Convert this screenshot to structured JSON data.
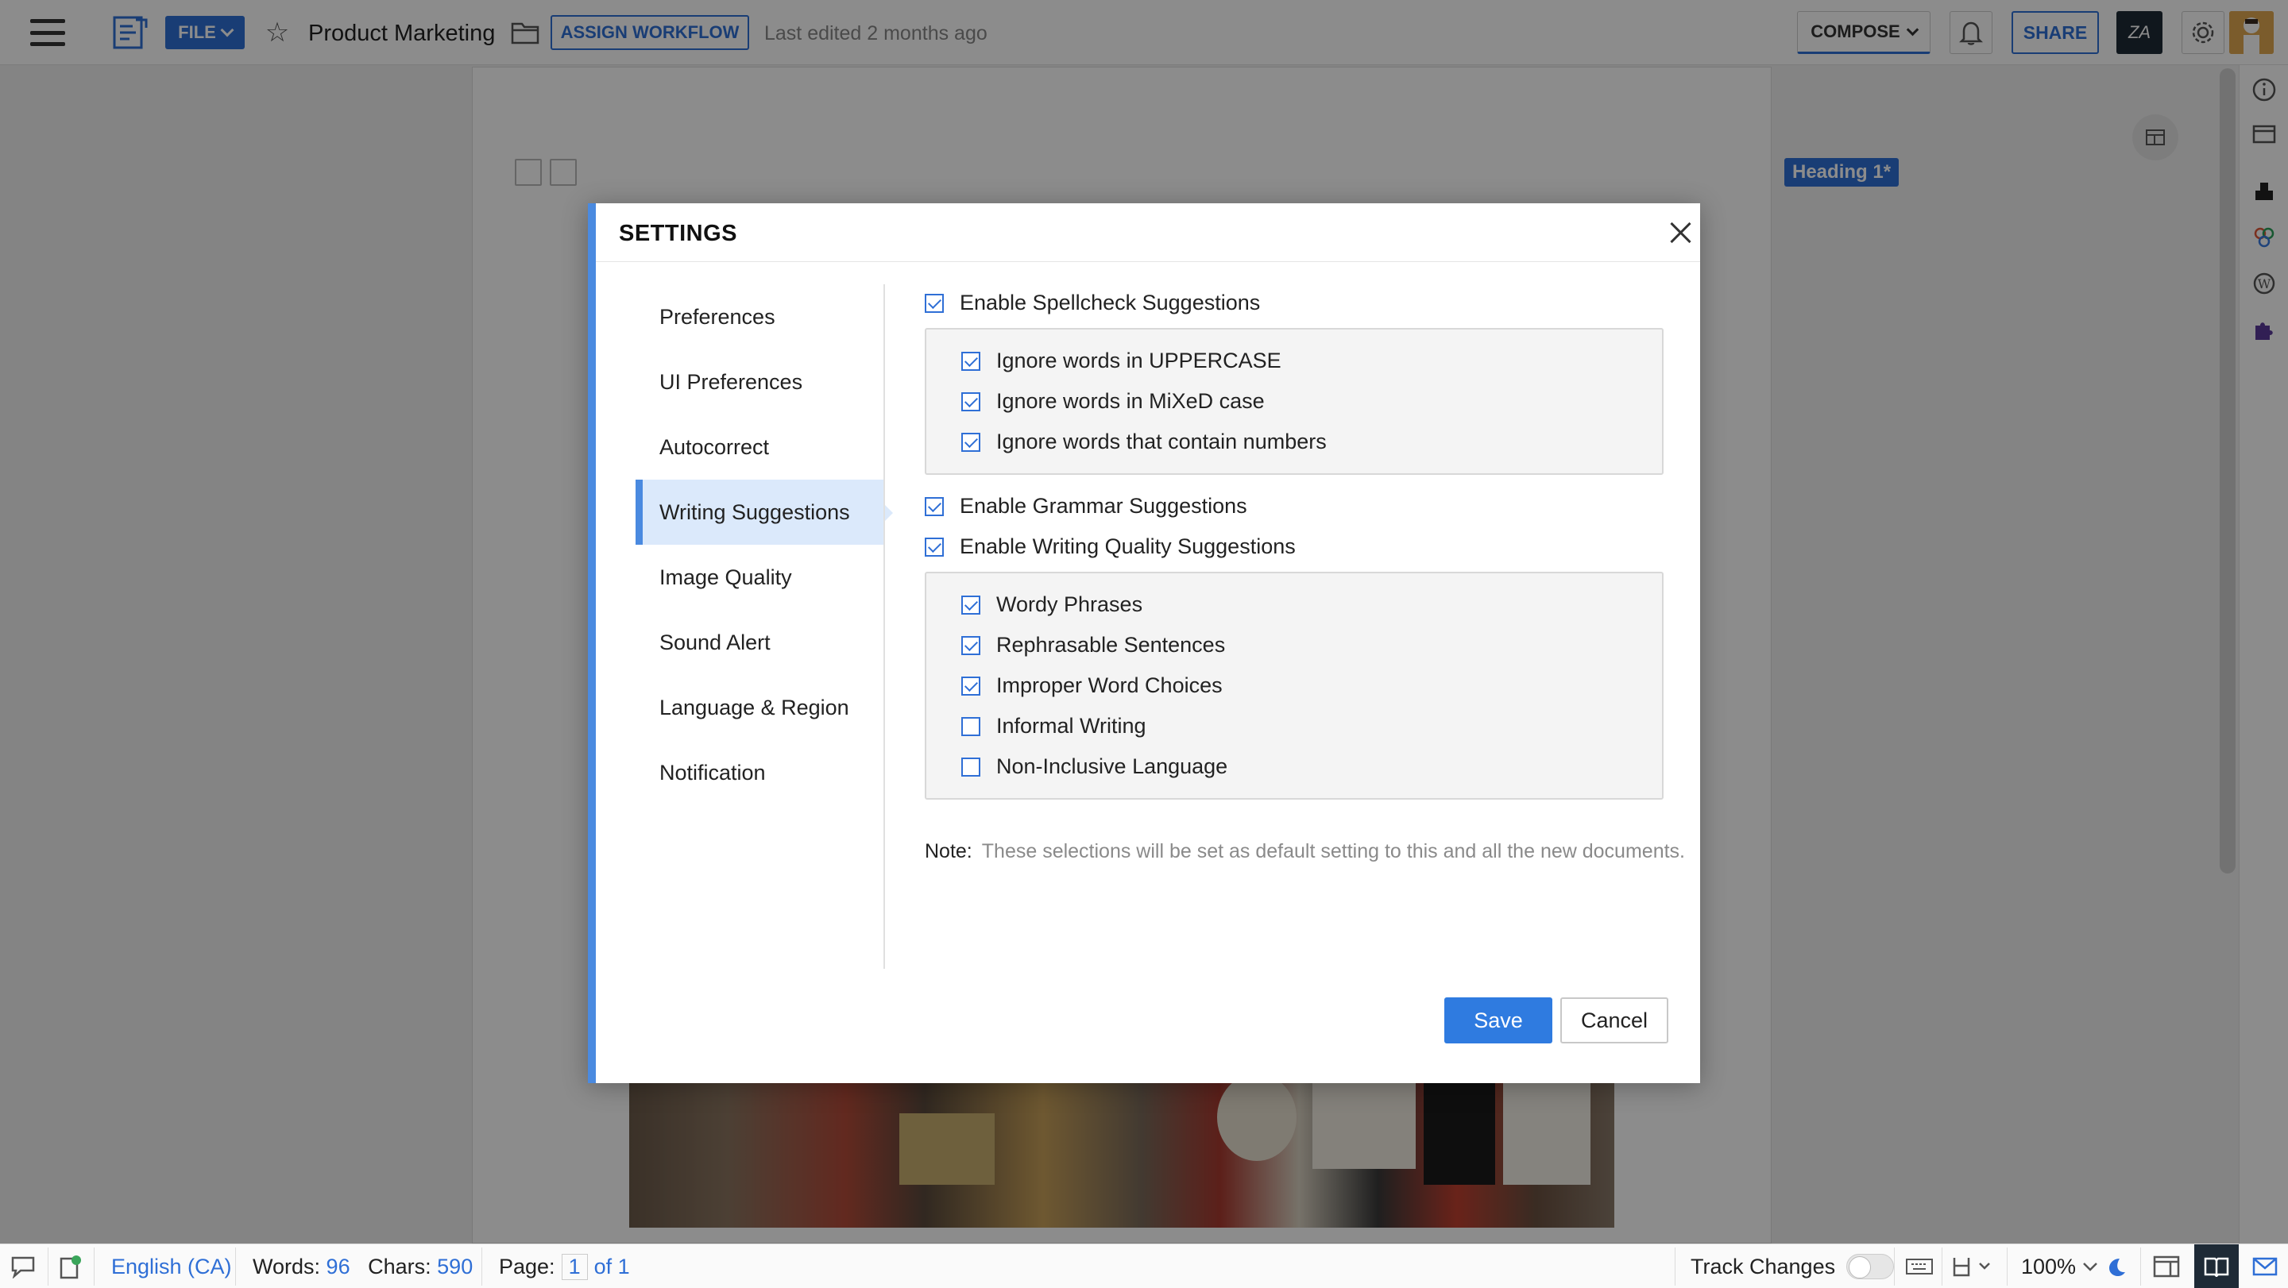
{
  "toolbar": {
    "file_label": "FILE",
    "doc_title": "Product Marketing",
    "assign_workflow_label": "ASSIGN WORKFLOW",
    "last_edited": "Last edited 2 months ago",
    "compose_label": "COMPOSE",
    "share_label": "SHARE",
    "za_label": "ZA"
  },
  "document": {
    "heading_tag": "Heading 1*"
  },
  "settings": {
    "title": "SETTINGS",
    "nav": [
      {
        "label": "Preferences",
        "active": false
      },
      {
        "label": "UI Preferences",
        "active": false
      },
      {
        "label": "Autocorrect",
        "active": false
      },
      {
        "label": "Writing Suggestions",
        "active": true
      },
      {
        "label": "Image Quality",
        "active": false
      },
      {
        "label": "Sound Alert",
        "active": false
      },
      {
        "label": "Language & Region",
        "active": false
      },
      {
        "label": "Notification",
        "active": false
      }
    ],
    "spellcheck": {
      "label": "Enable Spellcheck Suggestions",
      "checked": true
    },
    "spellcheck_options": [
      {
        "label": "Ignore words in UPPERCASE",
        "checked": true
      },
      {
        "label": "Ignore words in MiXeD case",
        "checked": true
      },
      {
        "label": "Ignore words that contain numbers",
        "checked": true
      }
    ],
    "grammar": {
      "label": "Enable Grammar Suggestions",
      "checked": true
    },
    "writing_quality": {
      "label": "Enable Writing Quality Suggestions",
      "checked": true
    },
    "writing_quality_options": [
      {
        "label": "Wordy Phrases",
        "checked": true
      },
      {
        "label": "Rephrasable Sentences",
        "checked": true
      },
      {
        "label": "Improper Word Choices",
        "checked": true
      },
      {
        "label": "Informal Writing",
        "checked": false
      },
      {
        "label": "Non-Inclusive Language",
        "checked": false
      }
    ],
    "note_label": "Note:",
    "note_text": "These selections will be set as default setting to this and all the new documents.",
    "save_label": "Save",
    "cancel_label": "Cancel"
  },
  "statusbar": {
    "language": "English (CA)",
    "words_label": "Words:",
    "words_value": "96",
    "chars_label": "Chars:",
    "chars_value": "590",
    "page_label": "Page:",
    "page_current": "1",
    "page_total": "of 1",
    "track_changes_label": "Track Changes",
    "zoom": "100%"
  },
  "colors": {
    "accent": "#2f6fd6",
    "dialog_accent": "#4a8ae0",
    "nav_active_bg": "#dbe9fb",
    "save_button": "#2f7be0"
  }
}
